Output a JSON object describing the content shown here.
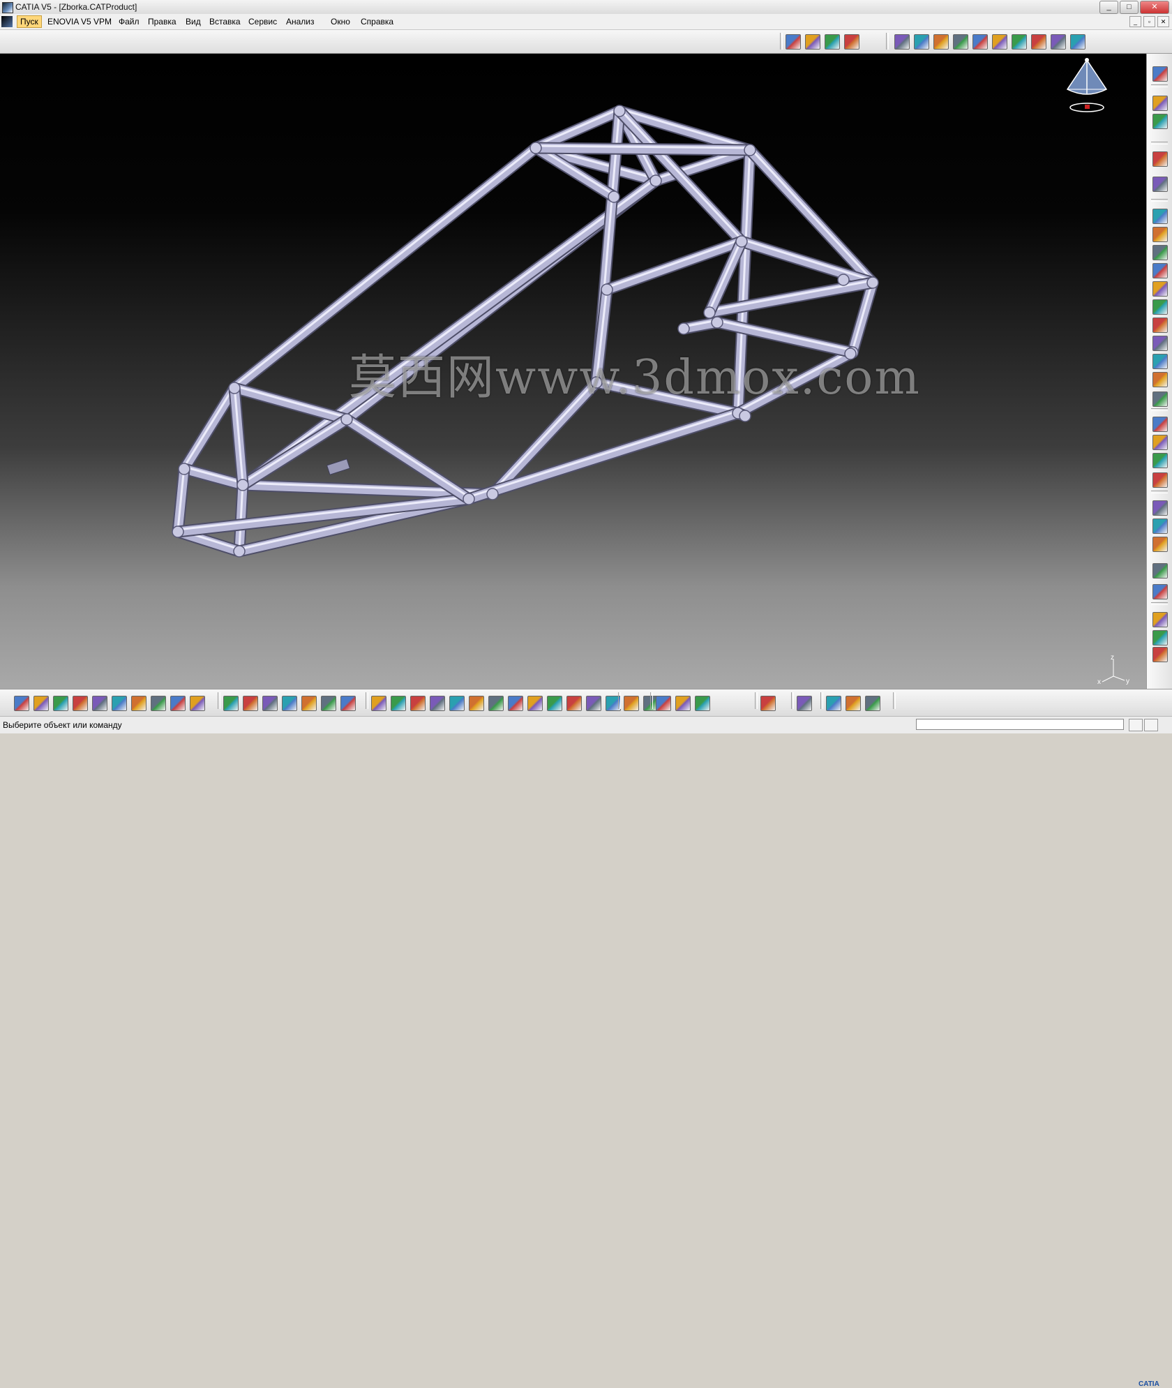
{
  "window": {
    "title": "CATIA V5 - [Zborka.CATProduct]",
    "controls": [
      "_",
      "□",
      "✕"
    ]
  },
  "menu": {
    "items": [
      "Пуск",
      "ENOVIA V5 VPM",
      "Файл",
      "Правка",
      "Вид",
      "Вставка",
      "Сервис",
      "Анализ",
      "Окно",
      "Справка"
    ],
    "doc_controls": [
      "_",
      "▫",
      "✕"
    ]
  },
  "status": {
    "message": "Выберите объект или команду",
    "command_value": ""
  },
  "watermark": "莫西网www.3dmox.com",
  "axis": {
    "x": "x",
    "y": "y",
    "z": "z"
  },
  "brand": "CATIA",
  "colors": {
    "tube": "#b8b8d6",
    "tube_dark": "#7e7e9e",
    "viewport_top": "#000000",
    "viewport_bottom": "#a9a9a9"
  },
  "icons": {
    "top_toolbar": [
      "product-icon",
      "component-icon",
      "part-icon",
      "existing-component-icon",
      "constraint-icon",
      "fix-icon",
      "coincidence-icon",
      "contact-icon",
      "offset-icon",
      "angle-icon",
      "fix-together-icon",
      "quick-constraint-icon",
      "update-icon",
      "manipulate-icon"
    ],
    "bottom_toolbar": [
      "new-icon",
      "open-icon",
      "save-icon",
      "print-icon",
      "cut-icon",
      "copy-icon",
      "paste-icon",
      "undo-icon",
      "redo-icon",
      "whats-this-icon",
      "formula-icon",
      "comment-icon",
      "knowledge-icon",
      "table-icon",
      "tree-icon",
      "lock-icon",
      "catalog-icon",
      "fly-mode-icon",
      "fit-all-icon",
      "pan-icon",
      "rotate-icon",
      "zoom-in-icon",
      "zoom-out-icon",
      "normal-view-icon",
      "multi-view-icon",
      "iso-view-icon",
      "shading-icon",
      "hide-show-icon",
      "swap-visible-icon",
      "capture-icon",
      "replace-icon",
      "measure-between-icon",
      "measure-item-icon",
      "measure-inertia-icon",
      "clash-icon",
      "sectioning-icon",
      "render-icon",
      "scene-icon",
      "material-icon",
      "grid-icon"
    ],
    "right_toolbar": [
      "settings-icon",
      "catalog-browser-icon",
      "params-icon",
      "select-icon",
      "snap-icon",
      "manipulate-icon",
      "explode-icon",
      "clash-icon",
      "sectioning-icon",
      "measure-icon",
      "distance-icon",
      "translate-icon",
      "annotation-icon",
      "text-icon",
      "capture-icon",
      "view-icon",
      "assembly-icon",
      "reorder-icon",
      "generate-icon",
      "bill-icon",
      "scene-icon",
      "flex-icon",
      "publish-icon",
      "save-mgmt-icon",
      "product-init-icon",
      "numbering-icon",
      "component-icon",
      "structure-icon"
    ]
  }
}
